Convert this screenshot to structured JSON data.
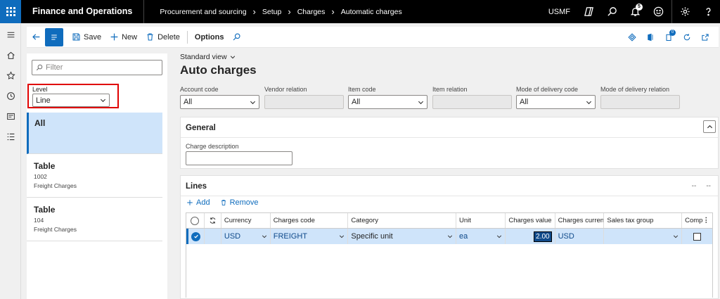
{
  "topbar": {
    "app_title": "Finance and Operations",
    "breadcrumbs": [
      "Procurement and sourcing",
      "Setup",
      "Charges",
      "Automatic charges"
    ],
    "company": "USMF",
    "notification_count": "5"
  },
  "actionpane": {
    "save_label": "Save",
    "new_label": "New",
    "delete_label": "Delete",
    "options_label": "Options",
    "attach_count": "0"
  },
  "listpanel": {
    "filter_placeholder": "Filter",
    "level_label": "Level",
    "level_value": "Line",
    "items": [
      {
        "title": "All",
        "code": "",
        "desc": ""
      },
      {
        "title": "Table",
        "code": "1002",
        "desc": "Freight Charges"
      },
      {
        "title": "Table",
        "code": "104",
        "desc": "Freight Charges"
      }
    ]
  },
  "main": {
    "view_label": "Standard view",
    "title": "Auto charges",
    "fields": [
      {
        "label": "Account code",
        "value": "All"
      },
      {
        "label": "Vendor relation",
        "value": ""
      },
      {
        "label": "Item code",
        "value": "All"
      },
      {
        "label": "Item relation",
        "value": ""
      },
      {
        "label": "Mode of delivery code",
        "value": "All"
      },
      {
        "label": "Mode of delivery relation",
        "value": ""
      }
    ]
  },
  "general": {
    "title": "General",
    "charge_description_label": "Charge description",
    "charge_description_value": ""
  },
  "lines": {
    "title": "Lines",
    "dash_left": "--",
    "dash_right": "--",
    "add_label": "Add",
    "remove_label": "Remove",
    "columns": [
      "Currency",
      "Charges code",
      "Category",
      "Unit",
      "Charges value",
      "Charges curren...",
      "Sales tax group",
      "Comp"
    ],
    "row": {
      "currency": "USD",
      "charges_code": "FREIGHT",
      "category": "Specific unit",
      "unit": "ea",
      "charges_value": "2.00",
      "charges_currency": "USD",
      "sales_tax_group": ""
    }
  },
  "colors": {
    "accent": "#0f6cbd",
    "selected_row": "#cfe4fa",
    "highlight_border": "#e00000"
  }
}
